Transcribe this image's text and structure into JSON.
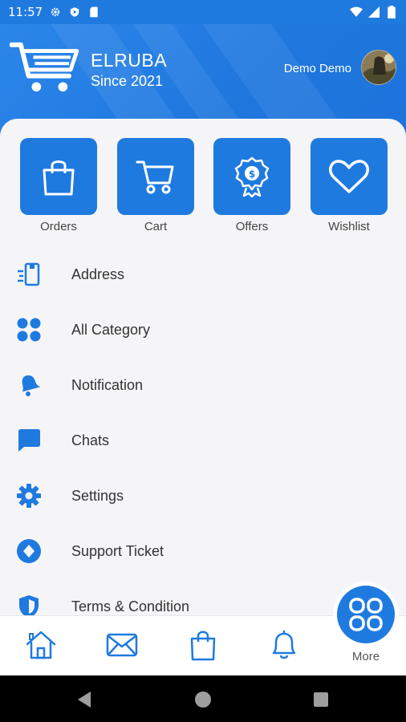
{
  "status_bar": {
    "time": "11:57",
    "icons": [
      "settings-icon",
      "shield-icon",
      "sd-card-icon",
      "wifi-icon",
      "signal-icon",
      "battery-icon"
    ]
  },
  "header": {
    "brand_name": "ELRUBA",
    "brand_since": "Since 2021",
    "user_name": "Demo Demo",
    "logo_icon": "shopping-cart-icon"
  },
  "tiles": [
    {
      "label": "Orders",
      "icon": "shopping-bag-icon"
    },
    {
      "label": "Cart",
      "icon": "cart-icon"
    },
    {
      "label": "Offers",
      "icon": "offer-badge-icon"
    },
    {
      "label": "Wishlist",
      "icon": "heart-icon"
    }
  ],
  "menu": [
    {
      "label": "Address",
      "icon": "address-icon"
    },
    {
      "label": "All Category",
      "icon": "category-icon"
    },
    {
      "label": "Notification",
      "icon": "bell-icon"
    },
    {
      "label": "Chats",
      "icon": "chat-icon"
    },
    {
      "label": "Settings",
      "icon": "gear-icon"
    },
    {
      "label": "Support Ticket",
      "icon": "support-icon"
    },
    {
      "label": "Terms & Condition",
      "icon": "shield-icon"
    }
  ],
  "bottom_nav": {
    "items": [
      "home-icon",
      "mail-icon",
      "bag-icon",
      "bell-icon"
    ],
    "more_label": "More"
  },
  "colors": {
    "primary": "#1f7ae0",
    "background": "#f5f5f7",
    "text": "#333333"
  }
}
